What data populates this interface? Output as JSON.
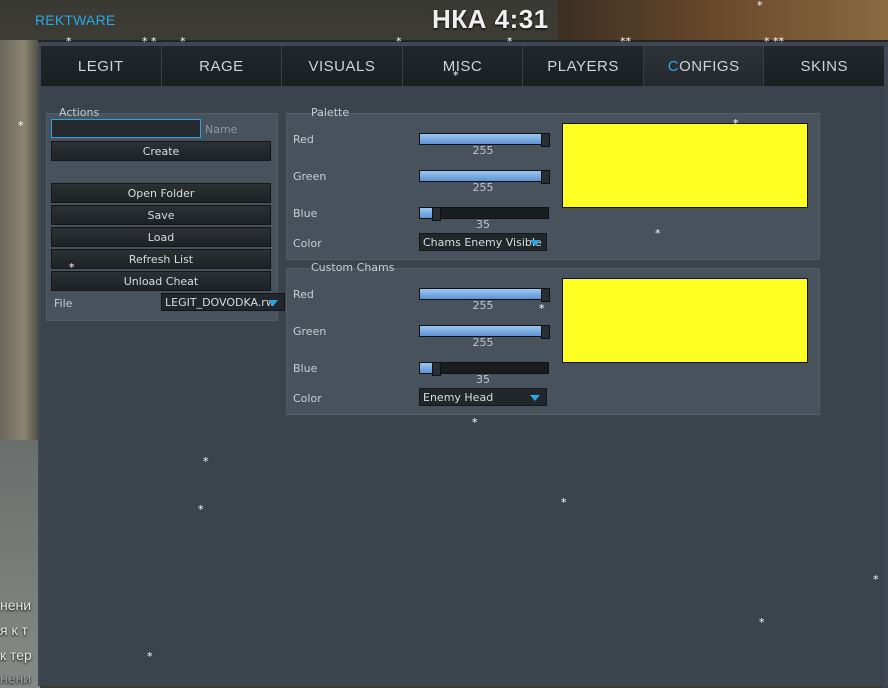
{
  "app": {
    "brand": "REKTWARE"
  },
  "hud": {
    "prefix": "НКА",
    "timer": "4:31"
  },
  "tabs": [
    {
      "label": "LEGIT"
    },
    {
      "label": "RAGE"
    },
    {
      "label": "VISUALS"
    },
    {
      "label": "MISC"
    },
    {
      "label": "PLAYERS"
    },
    {
      "label": "CONFIGS",
      "accent_letter": "C",
      "rest": "ONFIGS",
      "active": true
    },
    {
      "label": "SKINS"
    }
  ],
  "actions": {
    "title": "Actions",
    "name_value": "",
    "name_hint": "Name",
    "create": "Create",
    "open_folder": "Open Folder",
    "save": "Save",
    "load": "Load",
    "refresh_list": "Refresh List",
    "unload_cheat": "Unload Cheat",
    "file_label": "File",
    "file_selected": "LEGIT_DOVODKA.rw"
  },
  "palette": {
    "title": "Palette",
    "red": {
      "label": "Red",
      "value": "255",
      "fraction": 1.0
    },
    "green": {
      "label": "Green",
      "value": "255",
      "fraction": 1.0
    },
    "blue": {
      "label": "Blue",
      "value": "35",
      "fraction": 0.137
    },
    "color_label": "Color",
    "color_selected": "Chams Enemy Visible",
    "swatch_color": "#ffff23"
  },
  "custom_chams": {
    "title": "Custom Chams",
    "red": {
      "label": "Red",
      "value": "255",
      "fraction": 1.0
    },
    "green": {
      "label": "Green",
      "value": "255",
      "fraction": 1.0
    },
    "blue": {
      "label": "Blue",
      "value": "35",
      "fraction": 0.137
    },
    "color_label": "Color",
    "color_selected": "Enemy Head",
    "swatch_color": "#ffff23"
  },
  "background_text": [
    "нени",
    "я к т",
    "к тер",
    "нени"
  ],
  "colors": {
    "accent": "#29a8e6",
    "panel": "#47525c",
    "window": "#3b444d"
  }
}
